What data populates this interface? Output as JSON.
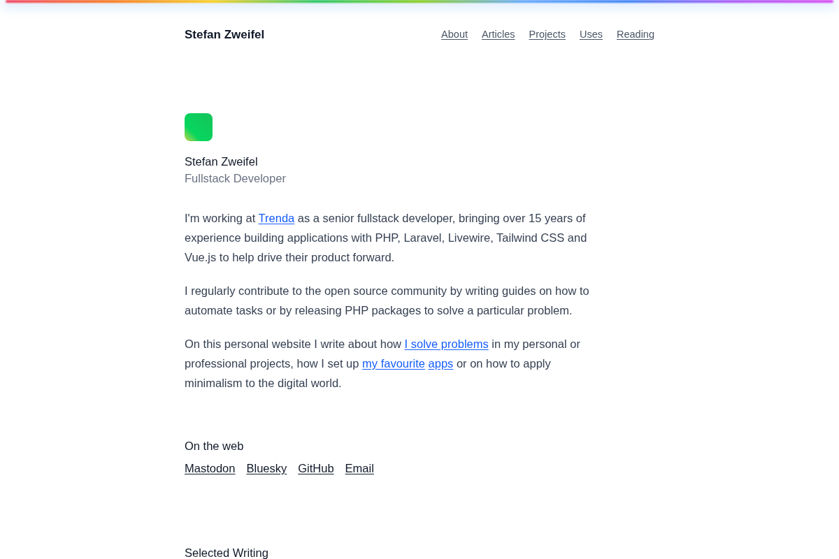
{
  "header": {
    "site_title": "Stefan Zweifel",
    "nav": [
      {
        "label": "About"
      },
      {
        "label": "Articles"
      },
      {
        "label": "Projects"
      },
      {
        "label": "Uses"
      },
      {
        "label": "Reading"
      }
    ]
  },
  "profile": {
    "name": "Stefan Zweifel",
    "role": "Fullstack Developer"
  },
  "intro": [
    [
      {
        "kind": "text",
        "text": "I'm working at "
      },
      {
        "kind": "link",
        "text": "Trenda"
      },
      {
        "kind": "text",
        "text": " as a senior fullstack developer, bringing over 15 years of experience building applications with PHP, Laravel, Livewire, Tailwind CSS and Vue.js to help drive their product forward."
      }
    ],
    [
      {
        "kind": "text",
        "text": "I regularly contribute to the open source community by writing guides on how to automate tasks or by releasing PHP packages to solve a particular problem."
      }
    ],
    [
      {
        "kind": "text",
        "text": "On this personal website I write about how "
      },
      {
        "kind": "link",
        "text": "I solve problems"
      },
      {
        "kind": "text",
        "text": " in my personal or professional projects, how I set up "
      },
      {
        "kind": "link",
        "text": "my favourite",
        "gap_after": true
      },
      {
        "kind": "link",
        "text": "apps"
      },
      {
        "kind": "text",
        "text": " or on how to apply minimalism to the digital world."
      }
    ]
  ],
  "on_the_web": {
    "heading": "On the web",
    "links": [
      {
        "label": "Mastodon"
      },
      {
        "label": "Bluesky"
      },
      {
        "label": "GitHub"
      },
      {
        "label": "Email"
      }
    ]
  },
  "selected_writing": {
    "heading": "Selected Writing"
  }
}
